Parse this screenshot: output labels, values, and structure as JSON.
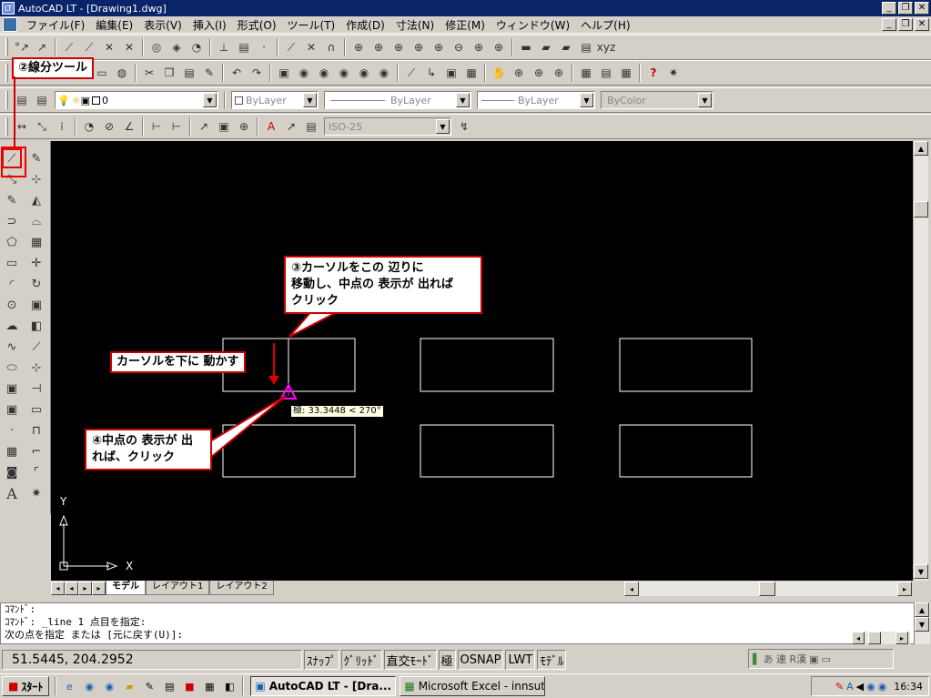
{
  "titlebar": {
    "title": "AutoCAD LT - [Drawing1.dwg]",
    "icon_text": "LT"
  },
  "window_buttons": [
    "_",
    "❐",
    "✕"
  ],
  "menu": [
    "ファイル(F)",
    "編集(E)",
    "表示(V)",
    "挿入(I)",
    "形式(O)",
    "ツール(T)",
    "作成(D)",
    "寸法(N)",
    "修正(M)",
    "ウィンドウ(W)",
    "ヘルプ(H)"
  ],
  "properties": {
    "layer": "0",
    "color": "ByLayer",
    "linetype": "ByLayer",
    "lineweight": "ByLayer",
    "plotstyle": "ByColor",
    "dimstyle": "ISO-25"
  },
  "canvas": {
    "tooltip": "極: 33.3448 < 270°",
    "axis_y": "Y",
    "axis_x": "X"
  },
  "callouts": {
    "tool": "②線分ツール",
    "move_here": "③カーソルをこの 辺りに\n移動し、中点の 表示が 出れば\nクリック",
    "move_down": "カーソルを下に 動かす",
    "click_mid": "④中点の 表示が 出\nれば、クリック"
  },
  "tabs": [
    "モデル",
    "レイアウト1",
    "レイアウト2"
  ],
  "command": {
    "line1": "ｺﾏﾝﾄﾞ:",
    "line2": "ｺﾏﾝﾄﾞ: _line 1 点目を指定:",
    "line3": "次の点を指定 または [元に戻す(U)]:"
  },
  "status": {
    "coords": "51.5445,   204.2952",
    "buttons": [
      "ｽﾅｯﾌﾟ",
      "ｸﾞﾘｯﾄﾞ",
      "直交ﾓｰﾄﾞ",
      "極",
      "OSNAP",
      "LWT",
      "ﾓﾃﾞﾙ"
    ],
    "ime": "あ 連 R漢"
  },
  "taskbar": {
    "start": "ｽﾀｰﾄ",
    "tasks": [
      "AutoCAD LT - [Dra...",
      "Microsoft Excel - innsut..."
    ],
    "time": "16:34"
  },
  "colors": {
    "accent_red": "#cc0000",
    "marker": "#ff00ff",
    "titlebar": "#0a246a"
  }
}
